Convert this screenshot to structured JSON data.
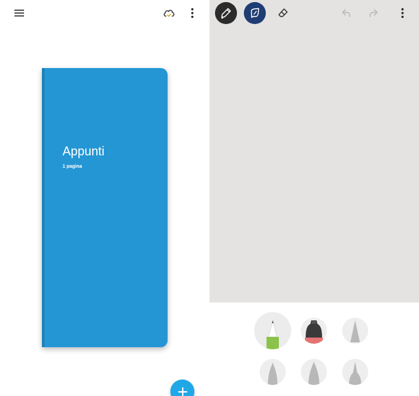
{
  "library": {
    "icons": {
      "menu": "hamburger-menu-icon",
      "cloud": "cloud-sync-icon",
      "more": "more-vertical-icon",
      "add": "plus-icon"
    },
    "notebook": {
      "title": "Appunti",
      "page_count": "1 pagina",
      "cover_color": "#2596d4"
    },
    "fab_color": "#1fa7e6"
  },
  "editor": {
    "toolbar": [
      {
        "name": "pen-tool",
        "icon": "pen-icon",
        "selected": true
      },
      {
        "name": "highlighter-tool",
        "icon": "highlighter-icon",
        "selected": false
      },
      {
        "name": "eraser-tool",
        "icon": "eraser-icon",
        "selected": false
      },
      {
        "name": "undo",
        "icon": "undo-icon",
        "enabled": false
      },
      {
        "name": "redo",
        "icon": "redo-icon",
        "enabled": false
      },
      {
        "name": "more",
        "icon": "more-vertical-icon"
      }
    ],
    "canvas_color": "#e5e3e2",
    "brushes": [
      {
        "name": "pencil",
        "tip_color": "#8bc34a",
        "selected": true
      },
      {
        "name": "marker",
        "tip_color": "#e57373"
      },
      {
        "name": "brush-3"
      },
      {
        "name": "brush-4"
      },
      {
        "name": "brush-5"
      },
      {
        "name": "brush-6"
      }
    ]
  }
}
